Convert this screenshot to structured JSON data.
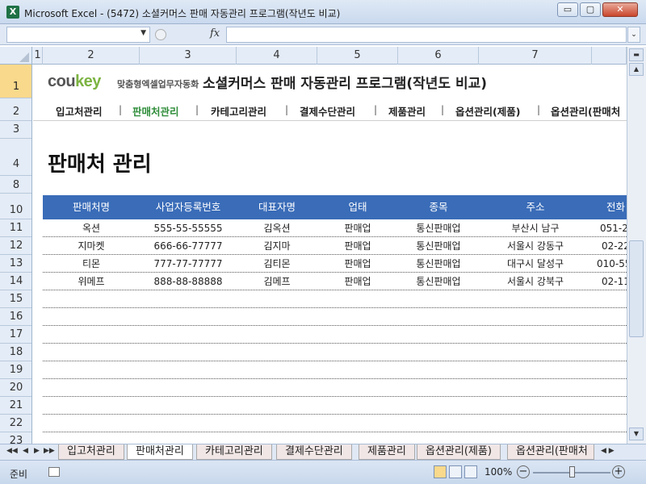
{
  "window": {
    "title": "Microsoft Excel - (5472) 소셜커머스 판매 자동관리 프로그램(작년도 비교)",
    "app_icon": "X",
    "minimize_icon": "▭",
    "maximize_icon": "▢",
    "close_icon": "✕"
  },
  "formula_bar": {
    "namebox_value": "",
    "fx_label": "fx",
    "formula_value": ""
  },
  "columns": [
    "1",
    "2",
    "3",
    "4",
    "5",
    "6",
    "7"
  ],
  "rows": [
    "1",
    "2",
    "3",
    "4",
    "8",
    "10",
    "11",
    "12",
    "13",
    "14",
    "15",
    "16",
    "17",
    "18",
    "19",
    "20",
    "21",
    "22",
    "23"
  ],
  "brand": {
    "logo_part1": "cou",
    "logo_part2": "key",
    "tagline": "맞춤형엑셀업무자동화",
    "title": "소셜커머스 판매 자동관리 프로그램(작년도 비교)",
    "accent_color": "#7cb342"
  },
  "menu": {
    "items": [
      "입고처관리",
      "판매처관리",
      "카테고리관리",
      "결제수단관리",
      "제품관리",
      "옵션관리(제품)",
      "옵션관리(판매처"
    ],
    "active_index": 1,
    "separator": "|"
  },
  "page_heading": "판매처 관리",
  "table": {
    "header_color": "#3a6cb8",
    "columns": [
      "판매처명",
      "사업자등록번호",
      "대표자명",
      "업태",
      "종목",
      "주소",
      "전화"
    ],
    "rows": [
      [
        "옥션",
        "555-55-55555",
        "김옥션",
        "판매업",
        "통신판매업",
        "부산시 남구",
        "051-2"
      ],
      [
        "지마켓",
        "666-66-77777",
        "김지마",
        "판매업",
        "통신판매업",
        "서울시 강동구",
        "02-22"
      ],
      [
        "티몬",
        "777-77-77777",
        "김티몬",
        "판매업",
        "통신판매업",
        "대구시 달성구",
        "010-55"
      ],
      [
        "위메프",
        "888-88-88888",
        "김메프",
        "판매업",
        "통신판매업",
        "서울시 강북구",
        "02-11"
      ]
    ]
  },
  "sheet_tabs": {
    "tabs": [
      "입고처관리",
      "판매처관리",
      "카테고리관리",
      "결제수단관리",
      "제품관리",
      "옵션관리(제품)",
      "옵션관리(판매처"
    ],
    "active_index": 1,
    "nav_icons": [
      "◀◀",
      "◀",
      "▶",
      "▶▶"
    ]
  },
  "status_bar": {
    "status": "준비",
    "zoom": "100%",
    "zoom_fraction": 0.5,
    "zoom_out": "−",
    "zoom_in": "+"
  }
}
